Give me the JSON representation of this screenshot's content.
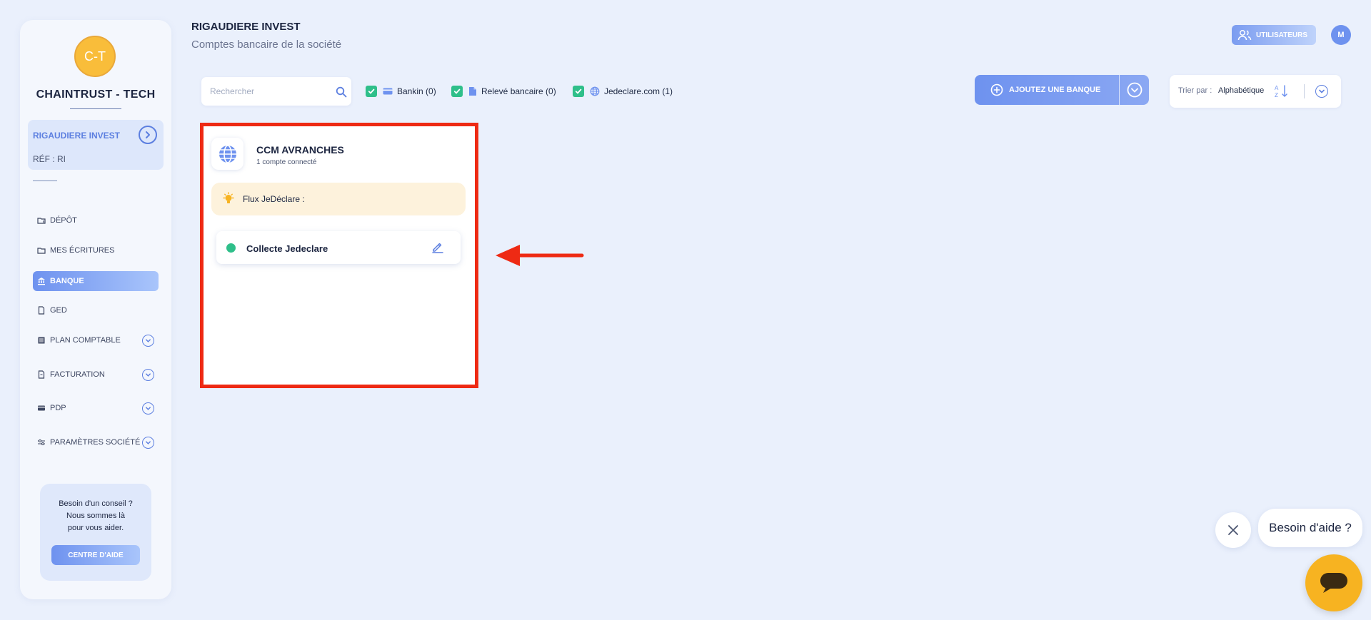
{
  "sidebar": {
    "logo_initials": "C-T",
    "company_name": "CHAINTRUST - TECH",
    "client": {
      "name": "RIGAUDIERE INVEST",
      "ref": "RÉF : RI"
    },
    "items": [
      {
        "label": "DÉPÔT"
      },
      {
        "label": "MES ÉCRITURES"
      },
      {
        "label": "BANQUE"
      },
      {
        "label": "GED"
      },
      {
        "label": "PLAN COMPTABLE"
      },
      {
        "label": "FACTURATION"
      },
      {
        "label": "PDP"
      },
      {
        "label": "PARAMÈTRES SOCIÉTÉ"
      }
    ],
    "help": {
      "line1": "Besoin d'un conseil ?",
      "line2": "Nous sommes là",
      "line3": "pour vous aider.",
      "button": "CENTRE D'AIDE"
    }
  },
  "header": {
    "title": "RIGAUDIERE INVEST",
    "subtitle": "Comptes bancaire de la société",
    "users_button": "UTILISATEURS",
    "avatar_initial": "M"
  },
  "toolbar": {
    "search_placeholder": "Rechercher",
    "filters": [
      {
        "label": "Bankin (0)",
        "checked": true
      },
      {
        "label": "Relevé bancaire (0)",
        "checked": true
      },
      {
        "label": "Jedeclare.com (1)",
        "checked": true
      }
    ],
    "add_bank_label": "AJOUTEZ UNE BANQUE",
    "sort_label": "Trier par :",
    "sort_value": "Alphabétique"
  },
  "bank_card": {
    "name": "CCM AVRANCHES",
    "accounts": "1 compte connecté",
    "flux_label": "Flux JeDéclare :",
    "collect_name": "Collecte Jedeclare",
    "status_color": "#2fbf8a"
  },
  "chat": {
    "bubble": "Besoin d'aide ?"
  },
  "colors": {
    "accent": "#6e92ef",
    "highlight": "#ee2a14",
    "success": "#2fbf8a",
    "warning_bg": "#fdf2dc",
    "chat": "#f7b321"
  }
}
